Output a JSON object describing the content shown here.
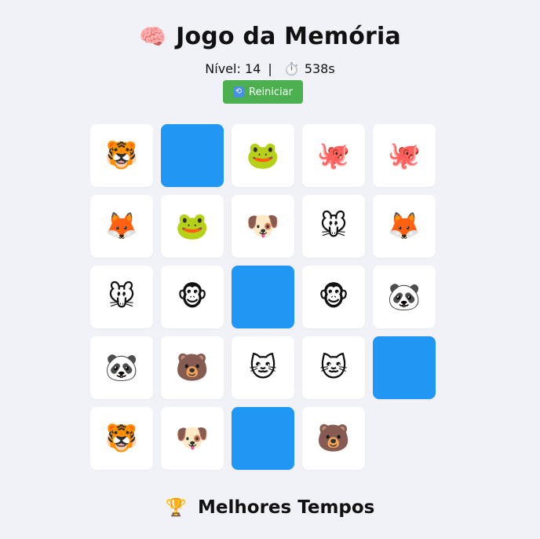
{
  "header": {
    "title_icon": "🧠",
    "title": "Jogo da Memória"
  },
  "status": {
    "level_label": "Nível:",
    "level": "14",
    "separator": "|",
    "timer_icon": "⏱️",
    "time": "538s"
  },
  "restart_button": {
    "icon": "🔁",
    "label": "Reiniciar"
  },
  "board": {
    "columns": 5,
    "cards": [
      {
        "state": "revealed",
        "emoji": "🐯",
        "name": "tiger"
      },
      {
        "state": "hidden",
        "emoji": "",
        "name": "hidden"
      },
      {
        "state": "revealed",
        "emoji": "🐸",
        "name": "frog"
      },
      {
        "state": "revealed",
        "emoji": "🐙",
        "name": "octopus"
      },
      {
        "state": "revealed",
        "emoji": "🐙",
        "name": "octopus"
      },
      {
        "state": "revealed",
        "emoji": "🦊",
        "name": "fox"
      },
      {
        "state": "revealed",
        "emoji": "🐸",
        "name": "frog"
      },
      {
        "state": "revealed",
        "emoji": "🐶",
        "name": "dog"
      },
      {
        "state": "revealed",
        "emoji": "🐭",
        "name": "mouse"
      },
      {
        "state": "revealed",
        "emoji": "🦊",
        "name": "fox"
      },
      {
        "state": "revealed",
        "emoji": "🐭",
        "name": "mouse"
      },
      {
        "state": "revealed",
        "emoji": "🐵",
        "name": "monkey"
      },
      {
        "state": "hidden",
        "emoji": "",
        "name": "hidden"
      },
      {
        "state": "revealed",
        "emoji": "🐵",
        "name": "monkey"
      },
      {
        "state": "revealed",
        "emoji": "🐼",
        "name": "panda"
      },
      {
        "state": "revealed",
        "emoji": "🐼",
        "name": "panda"
      },
      {
        "state": "revealed",
        "emoji": "🐻",
        "name": "bear"
      },
      {
        "state": "revealed",
        "emoji": "🐱",
        "name": "cat"
      },
      {
        "state": "revealed",
        "emoji": "🐱",
        "name": "cat"
      },
      {
        "state": "hidden",
        "emoji": "",
        "name": "hidden"
      },
      {
        "state": "revealed",
        "emoji": "🐯",
        "name": "tiger"
      },
      {
        "state": "revealed",
        "emoji": "🐶",
        "name": "dog"
      },
      {
        "state": "hidden",
        "emoji": "",
        "name": "hidden"
      },
      {
        "state": "revealed",
        "emoji": "🐻",
        "name": "bear"
      },
      {
        "state": "empty",
        "emoji": "",
        "name": "empty"
      }
    ],
    "colors": {
      "hidden_card": "#2196f3",
      "revealed_card": "#ffffff",
      "restart_button": "#4caf50",
      "background": "#f0f2f7"
    }
  },
  "best_times": {
    "icon": "🏆",
    "title": "Melhores Tempos"
  }
}
